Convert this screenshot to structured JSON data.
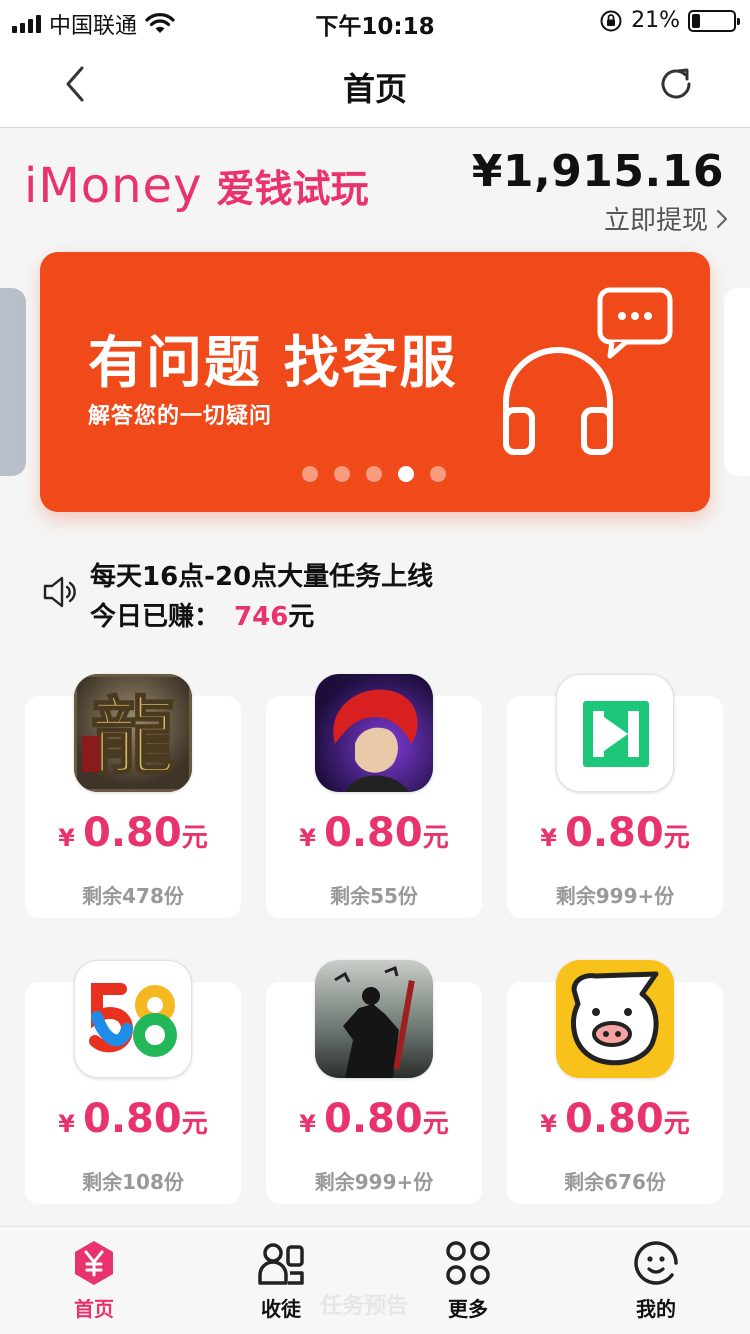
{
  "status_bar": {
    "carrier": "中国联通",
    "time": "下午10:18",
    "battery": "21%",
    "battery_level": 0.21
  },
  "nav": {
    "title": "首页",
    "back_icon": "chevron-left-icon",
    "refresh_icon": "refresh-icon"
  },
  "brand": {
    "logo": "iMoney",
    "name": "爱钱试玩"
  },
  "account": {
    "balance": "¥1,915.16",
    "withdraw_label": "立即提现"
  },
  "banner": {
    "title": "有问题 找客服",
    "subtitle": "解答您的一切疑问",
    "slide_count": 5,
    "active_index": 3,
    "colors": {
      "background": "#f04a1a"
    }
  },
  "notice": {
    "line1": "每天16点-20点大量任务上线",
    "earned_label": "今日已赚：",
    "earned_amount": "746",
    "earned_unit": "元"
  },
  "tasks": [
    {
      "icon": "dragon-game-icon",
      "currency": "¥",
      "price": "0.80",
      "unit": "元",
      "remaining": "剩余478份"
    },
    {
      "icon": "fighter-game-icon",
      "currency": "¥",
      "price": "0.80",
      "unit": "元",
      "remaining": "剩余55份"
    },
    {
      "icon": "n-logo-app-icon",
      "currency": "¥",
      "price": "0.80",
      "unit": "元",
      "remaining": "剩余999+份"
    },
    {
      "icon": "58-app-icon",
      "currency": "¥",
      "price": "0.80",
      "unit": "元",
      "remaining": "剩余108份"
    },
    {
      "icon": "warrior-game-icon",
      "currency": "¥",
      "price": "0.80",
      "unit": "元",
      "remaining": "剩余999+份"
    },
    {
      "icon": "pig-app-icon",
      "currency": "¥",
      "price": "0.80",
      "unit": "元",
      "remaining": "剩余676份"
    }
  ],
  "tab_bar": {
    "items": [
      {
        "label": "首页",
        "icon": "yen-hexagon-icon",
        "active": true
      },
      {
        "label": "收徒",
        "icon": "people-icon",
        "active": false
      },
      {
        "label": "更多",
        "icon": "grid-icon",
        "active": false
      },
      {
        "label": "我的",
        "icon": "smiley-icon",
        "active": false
      }
    ],
    "ghost_text": "任务预告"
  },
  "colors": {
    "accent": "#e8336d",
    "banner": "#f04a1a"
  }
}
